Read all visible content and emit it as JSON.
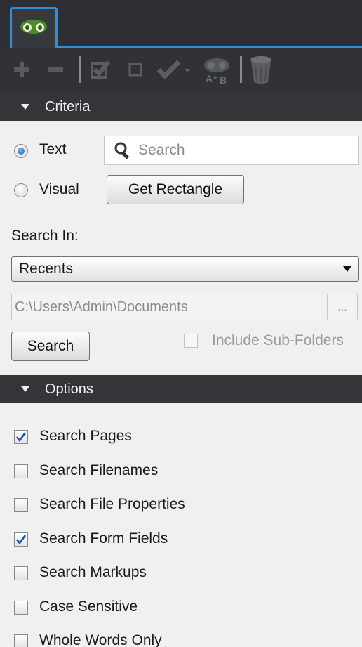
{
  "tab": {
    "icon": "binoculars-icon"
  },
  "toolbar": {
    "items": [
      {
        "name": "add-icon"
      },
      {
        "name": "remove-icon"
      },
      {
        "name": "check-all-icon"
      },
      {
        "name": "uncheck-icon"
      },
      {
        "name": "checkmark-dropdown-icon"
      },
      {
        "name": "compare-ab-icon"
      },
      {
        "name": "trash-icon"
      }
    ]
  },
  "criteria": {
    "header": "Criteria",
    "text_label": "Text",
    "visual_label": "Visual",
    "search_placeholder": "Search",
    "get_rectangle_label": "Get Rectangle",
    "search_in_label": "Search In:",
    "search_in_value": "Recents",
    "path_value": "C:\\Users\\Admin\\Documents",
    "browse_label": "...",
    "search_button": "Search",
    "include_subfolders": "Include Sub-Folders"
  },
  "options": {
    "header": "Options",
    "items": [
      {
        "label": "Search Pages",
        "checked": true
      },
      {
        "label": "Search Filenames",
        "checked": false
      },
      {
        "label": "Search File Properties",
        "checked": false
      },
      {
        "label": "Search Form Fields",
        "checked": true
      },
      {
        "label": "Search Markups",
        "checked": false
      },
      {
        "label": "Case Sensitive",
        "checked": false
      },
      {
        "label": "Whole Words Only",
        "checked": false
      }
    ]
  },
  "colors": {
    "accent": "#2f8fd8",
    "toolbar_bg": "#303236",
    "panel_bg": "#f0f0f0",
    "check": "#1f4fa8"
  }
}
